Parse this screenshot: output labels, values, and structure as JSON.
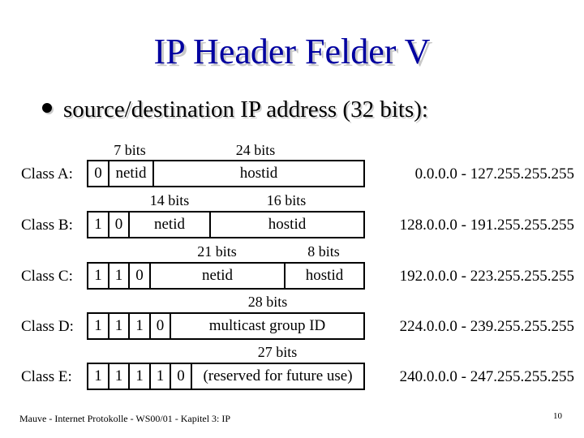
{
  "slide": {
    "title": "IP Header Felder V",
    "bullet": "source/destination IP address (32 bits):",
    "footer": "Mauve - Internet Protokolle - WS00/01 - Kapitel 3: IP",
    "page_number": "10",
    "title_color": "#0000a0"
  },
  "classes": [
    {
      "label": "Class A:",
      "bit_labels": [
        "7 bits",
        "24 bits"
      ],
      "cells": [
        "0",
        "netid",
        "hostid"
      ],
      "range": "0.0.0.0 - 127.255.255.255"
    },
    {
      "label": "Class B:",
      "bit_labels": [
        "14 bits",
        "16 bits"
      ],
      "cells": [
        "1",
        "0",
        "netid",
        "hostid"
      ],
      "range": "128.0.0.0 - 191.255.255.255"
    },
    {
      "label": "Class C:",
      "bit_labels": [
        "21 bits",
        "8 bits"
      ],
      "cells": [
        "1",
        "1",
        "0",
        "netid",
        "hostid"
      ],
      "range": "192.0.0.0 - 223.255.255.255"
    },
    {
      "label": "Class D:",
      "bit_labels": [
        "28 bits"
      ],
      "cells": [
        "1",
        "1",
        "1",
        "0",
        "multicast group ID"
      ],
      "range": "224.0.0.0 - 239.255.255.255"
    },
    {
      "label": "Class E:",
      "bit_labels": [
        "27 bits"
      ],
      "cells": [
        "1",
        "1",
        "1",
        "1",
        "0",
        "(reserved for future use)"
      ],
      "range": "240.0.0.0 - 247.255.255.255"
    }
  ]
}
